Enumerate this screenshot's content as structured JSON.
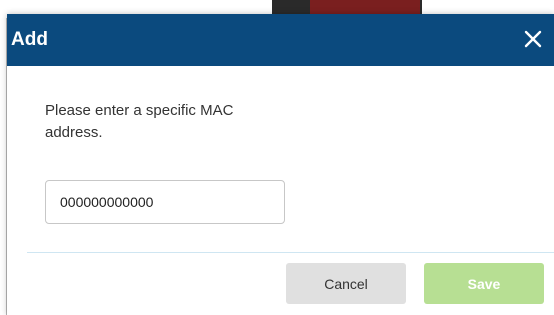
{
  "dialog": {
    "title": "Add",
    "close_icon": "close-icon",
    "message": "Please enter a specific MAC address.",
    "mac_input": {
      "value": "000000000000",
      "placeholder": ""
    },
    "buttons": {
      "cancel_label": "Cancel",
      "save_label": "Save"
    }
  },
  "colors": {
    "header_background": "#0b4a7e",
    "header_text": "#ffffff",
    "save_button_disabled": "#b7df93",
    "cancel_button": "#e0e0e0",
    "divider": "#cfe6f2"
  }
}
